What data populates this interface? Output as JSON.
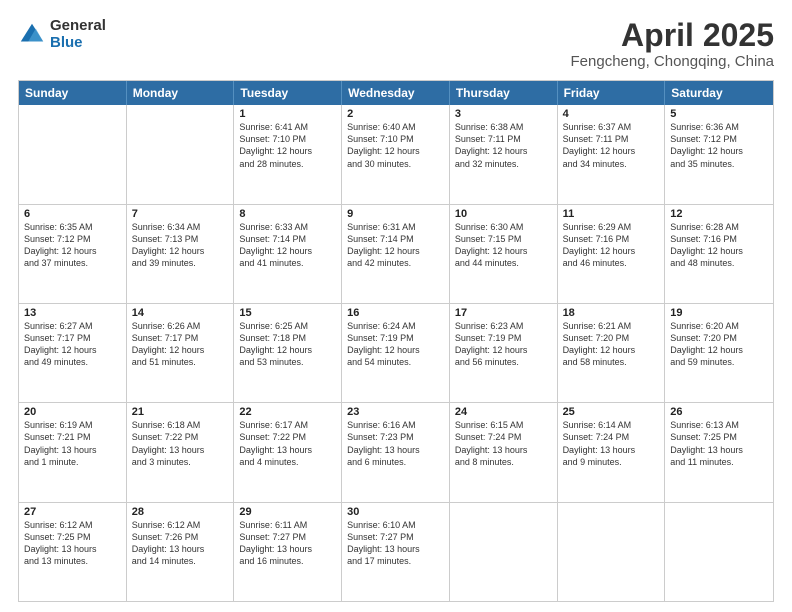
{
  "logo": {
    "general": "General",
    "blue": "Blue"
  },
  "title": {
    "month": "April 2025",
    "location": "Fengcheng, Chongqing, China"
  },
  "days": [
    "Sunday",
    "Monday",
    "Tuesday",
    "Wednesday",
    "Thursday",
    "Friday",
    "Saturday"
  ],
  "weeks": [
    [
      {
        "day": "",
        "lines": []
      },
      {
        "day": "",
        "lines": []
      },
      {
        "day": "1",
        "lines": [
          "Sunrise: 6:41 AM",
          "Sunset: 7:10 PM",
          "Daylight: 12 hours",
          "and 28 minutes."
        ]
      },
      {
        "day": "2",
        "lines": [
          "Sunrise: 6:40 AM",
          "Sunset: 7:10 PM",
          "Daylight: 12 hours",
          "and 30 minutes."
        ]
      },
      {
        "day": "3",
        "lines": [
          "Sunrise: 6:38 AM",
          "Sunset: 7:11 PM",
          "Daylight: 12 hours",
          "and 32 minutes."
        ]
      },
      {
        "day": "4",
        "lines": [
          "Sunrise: 6:37 AM",
          "Sunset: 7:11 PM",
          "Daylight: 12 hours",
          "and 34 minutes."
        ]
      },
      {
        "day": "5",
        "lines": [
          "Sunrise: 6:36 AM",
          "Sunset: 7:12 PM",
          "Daylight: 12 hours",
          "and 35 minutes."
        ]
      }
    ],
    [
      {
        "day": "6",
        "lines": [
          "Sunrise: 6:35 AM",
          "Sunset: 7:12 PM",
          "Daylight: 12 hours",
          "and 37 minutes."
        ]
      },
      {
        "day": "7",
        "lines": [
          "Sunrise: 6:34 AM",
          "Sunset: 7:13 PM",
          "Daylight: 12 hours",
          "and 39 minutes."
        ]
      },
      {
        "day": "8",
        "lines": [
          "Sunrise: 6:33 AM",
          "Sunset: 7:14 PM",
          "Daylight: 12 hours",
          "and 41 minutes."
        ]
      },
      {
        "day": "9",
        "lines": [
          "Sunrise: 6:31 AM",
          "Sunset: 7:14 PM",
          "Daylight: 12 hours",
          "and 42 minutes."
        ]
      },
      {
        "day": "10",
        "lines": [
          "Sunrise: 6:30 AM",
          "Sunset: 7:15 PM",
          "Daylight: 12 hours",
          "and 44 minutes."
        ]
      },
      {
        "day": "11",
        "lines": [
          "Sunrise: 6:29 AM",
          "Sunset: 7:16 PM",
          "Daylight: 12 hours",
          "and 46 minutes."
        ]
      },
      {
        "day": "12",
        "lines": [
          "Sunrise: 6:28 AM",
          "Sunset: 7:16 PM",
          "Daylight: 12 hours",
          "and 48 minutes."
        ]
      }
    ],
    [
      {
        "day": "13",
        "lines": [
          "Sunrise: 6:27 AM",
          "Sunset: 7:17 PM",
          "Daylight: 12 hours",
          "and 49 minutes."
        ]
      },
      {
        "day": "14",
        "lines": [
          "Sunrise: 6:26 AM",
          "Sunset: 7:17 PM",
          "Daylight: 12 hours",
          "and 51 minutes."
        ]
      },
      {
        "day": "15",
        "lines": [
          "Sunrise: 6:25 AM",
          "Sunset: 7:18 PM",
          "Daylight: 12 hours",
          "and 53 minutes."
        ]
      },
      {
        "day": "16",
        "lines": [
          "Sunrise: 6:24 AM",
          "Sunset: 7:19 PM",
          "Daylight: 12 hours",
          "and 54 minutes."
        ]
      },
      {
        "day": "17",
        "lines": [
          "Sunrise: 6:23 AM",
          "Sunset: 7:19 PM",
          "Daylight: 12 hours",
          "and 56 minutes."
        ]
      },
      {
        "day": "18",
        "lines": [
          "Sunrise: 6:21 AM",
          "Sunset: 7:20 PM",
          "Daylight: 12 hours",
          "and 58 minutes."
        ]
      },
      {
        "day": "19",
        "lines": [
          "Sunrise: 6:20 AM",
          "Sunset: 7:20 PM",
          "Daylight: 12 hours",
          "and 59 minutes."
        ]
      }
    ],
    [
      {
        "day": "20",
        "lines": [
          "Sunrise: 6:19 AM",
          "Sunset: 7:21 PM",
          "Daylight: 13 hours",
          "and 1 minute."
        ]
      },
      {
        "day": "21",
        "lines": [
          "Sunrise: 6:18 AM",
          "Sunset: 7:22 PM",
          "Daylight: 13 hours",
          "and 3 minutes."
        ]
      },
      {
        "day": "22",
        "lines": [
          "Sunrise: 6:17 AM",
          "Sunset: 7:22 PM",
          "Daylight: 13 hours",
          "and 4 minutes."
        ]
      },
      {
        "day": "23",
        "lines": [
          "Sunrise: 6:16 AM",
          "Sunset: 7:23 PM",
          "Daylight: 13 hours",
          "and 6 minutes."
        ]
      },
      {
        "day": "24",
        "lines": [
          "Sunrise: 6:15 AM",
          "Sunset: 7:24 PM",
          "Daylight: 13 hours",
          "and 8 minutes."
        ]
      },
      {
        "day": "25",
        "lines": [
          "Sunrise: 6:14 AM",
          "Sunset: 7:24 PM",
          "Daylight: 13 hours",
          "and 9 minutes."
        ]
      },
      {
        "day": "26",
        "lines": [
          "Sunrise: 6:13 AM",
          "Sunset: 7:25 PM",
          "Daylight: 13 hours",
          "and 11 minutes."
        ]
      }
    ],
    [
      {
        "day": "27",
        "lines": [
          "Sunrise: 6:12 AM",
          "Sunset: 7:25 PM",
          "Daylight: 13 hours",
          "and 13 minutes."
        ]
      },
      {
        "day": "28",
        "lines": [
          "Sunrise: 6:12 AM",
          "Sunset: 7:26 PM",
          "Daylight: 13 hours",
          "and 14 minutes."
        ]
      },
      {
        "day": "29",
        "lines": [
          "Sunrise: 6:11 AM",
          "Sunset: 7:27 PM",
          "Daylight: 13 hours",
          "and 16 minutes."
        ]
      },
      {
        "day": "30",
        "lines": [
          "Sunrise: 6:10 AM",
          "Sunset: 7:27 PM",
          "Daylight: 13 hours",
          "and 17 minutes."
        ]
      },
      {
        "day": "",
        "lines": []
      },
      {
        "day": "",
        "lines": []
      },
      {
        "day": "",
        "lines": []
      }
    ]
  ]
}
